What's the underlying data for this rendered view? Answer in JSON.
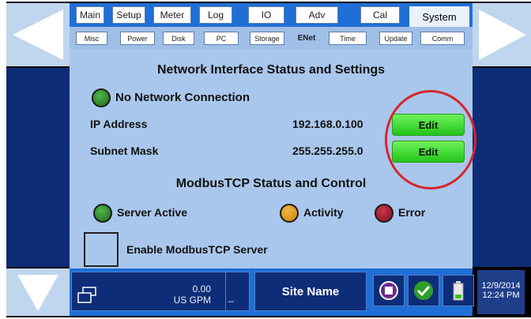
{
  "tabs_main": [
    {
      "label": "Main"
    },
    {
      "label": "Setup"
    },
    {
      "label": "Meter"
    },
    {
      "label": "Log"
    },
    {
      "label": "IO"
    },
    {
      "label": "Adv"
    },
    {
      "label": "Cal"
    },
    {
      "label": "System",
      "active": true
    }
  ],
  "tabs_sub": [
    {
      "label": "Misc"
    },
    {
      "label": "Power"
    },
    {
      "label": "Disk"
    },
    {
      "label": "PC"
    },
    {
      "label": "Storage"
    },
    {
      "label": "ENet",
      "active": true
    },
    {
      "label": "Time"
    },
    {
      "label": "Update"
    },
    {
      "label": "Comm"
    }
  ],
  "network": {
    "title": "Network Interface Status and Settings",
    "status_label": "No Network Connection",
    "ip_label": "IP Address",
    "ip_value": "192.168.0.100",
    "subnet_label": "Subnet Mask",
    "subnet_value": "255.255.255.0",
    "edit_label": "Edit"
  },
  "modbus": {
    "title": "ModbusTCP Status and Control",
    "server_active_label": "Server Active",
    "activity_label": "Activity",
    "error_label": "Error",
    "enable_label": "Enable ModbusTCP Server",
    "enabled": false
  },
  "footer": {
    "flow_value": "0.00",
    "flow_units": "US GPM",
    "flow_marker": "_",
    "site_name": "Site Name",
    "date": "12/9/2014",
    "time": "12:24 PM"
  },
  "icons": {
    "left_arrow": "left-arrow-icon",
    "right_arrow": "right-arrow-icon",
    "down_arrow": "down-arrow-icon",
    "windows": "windows-icon",
    "stop": "stop-icon",
    "check": "check-icon",
    "battery": "battery-icon"
  },
  "colors": {
    "status_green": "#3f9b39",
    "activity_orange": "#e0a02a",
    "error_red": "#b3223a",
    "edit_button_green": "#33d11e",
    "highlight_ring": "#d8242f",
    "tab_blue": "#1f6fd6",
    "panel_light_blue": "#a9c7ec"
  }
}
